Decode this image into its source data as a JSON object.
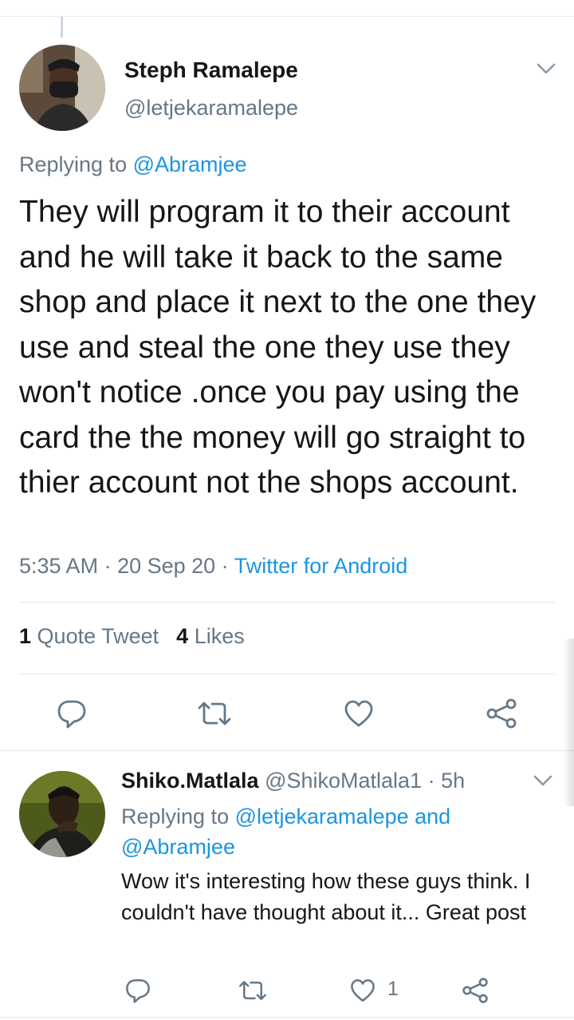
{
  "main_tweet": {
    "author_name": "Steph Ramalepe",
    "author_handle": "@letjekaramalepe",
    "replying_prefix": "Replying to ",
    "replying_to": "@Abramjee",
    "text": "They will program it to their account and he will take it back to the same shop and place it next to the one they use and steal the one they use they won't notice .once you pay using the card the the money will go straight to thier account not the shops account.",
    "time": "5:35 AM",
    "date": "20 Sep 20",
    "source": "Twitter for Android",
    "separator": " · ",
    "quote_count": "1",
    "quote_label": "Quote Tweet",
    "like_count": "4",
    "like_label": "Likes"
  },
  "reply_tweet": {
    "author_name": "Shiko.Matlala",
    "author_handle": "@ShikoMatlala1",
    "separator": " · ",
    "time_ago": "5h",
    "replying_prefix": "Replying to ",
    "replying_to_1": "@letjekaramalepe",
    "replying_and": " and",
    "replying_to_2": "@Abramjee",
    "text": "Wow it's interesting how these guys think. I couldn't have thought about it... Great post",
    "like_count": "1"
  },
  "icons": {
    "reply": "comment-icon",
    "retweet": "retweet-icon",
    "like": "heart-icon",
    "share": "share-icon",
    "menu": "chevron-down-icon"
  },
  "colors": {
    "link": "#1b95e0",
    "secondary_text": "#657786",
    "primary_text": "#14171a",
    "icon": "#657786"
  }
}
